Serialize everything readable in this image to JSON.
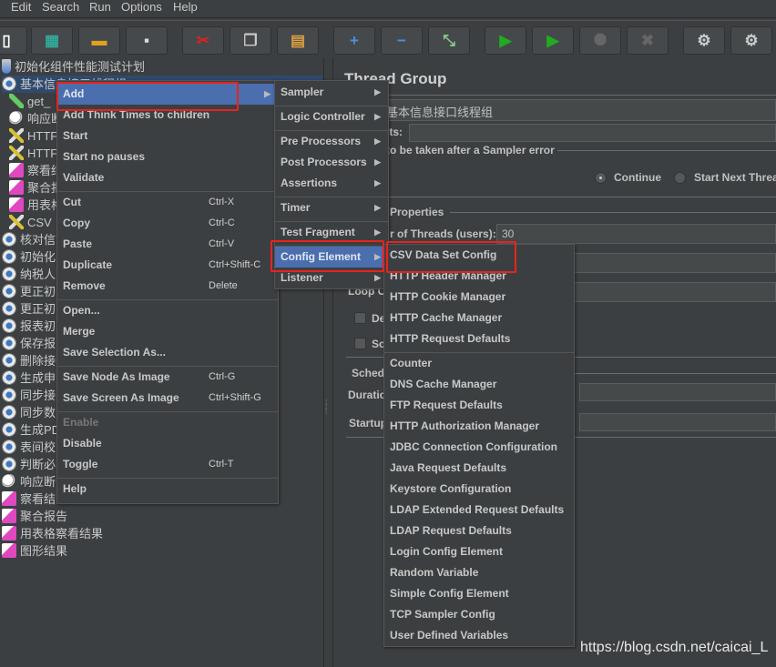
{
  "menubar": [
    "Edit",
    "Search",
    "Run",
    "Options",
    "Help"
  ],
  "toolbar": [
    {
      "icon": "new-icon",
      "g": "▯",
      "c": "#fff"
    },
    {
      "icon": "templates-icon",
      "g": "▦",
      "c": "#3a9"
    },
    {
      "icon": "open-icon",
      "g": "▬",
      "c": "#e0a020"
    },
    {
      "icon": "save-icon",
      "g": "▪",
      "c": "#ddd"
    },
    {
      "icon": "cut-icon",
      "g": "✂",
      "c": "#d22"
    },
    {
      "icon": "copy-icon",
      "g": "❐",
      "c": "#ccc"
    },
    {
      "icon": "paste-icon",
      "g": "▤",
      "c": "#e0a040"
    },
    {
      "icon": "expand-icon",
      "g": "+",
      "c": "#4a90e2"
    },
    {
      "icon": "collapse-icon",
      "g": "−",
      "c": "#4a90e2"
    },
    {
      "icon": "toggle-icon",
      "g": "⤡",
      "c": "#8c8"
    },
    {
      "icon": "start-icon",
      "g": "▶",
      "c": "#2a2"
    },
    {
      "icon": "start-no-pauses-icon",
      "g": "▶",
      "c": "#2a2"
    },
    {
      "icon": "stop-icon",
      "g": "⯃",
      "c": "#666"
    },
    {
      "icon": "shutdown-icon",
      "g": "✖",
      "c": "#666"
    },
    {
      "icon": "clear-icon",
      "g": "⚙",
      "c": "#ccc"
    },
    {
      "icon": "clear-all-icon",
      "g": "⚙",
      "c": "#ccc"
    }
  ],
  "tree": [
    {
      "label": "初始化组件性能测试计划",
      "icon": "flask",
      "indent": 0
    },
    {
      "label": "基本信息接口线程组",
      "icon": "gear",
      "indent": 0,
      "selected": true
    },
    {
      "label": "get_",
      "icon": "pen",
      "indent": 1
    },
    {
      "label": "响应断",
      "icon": "glass",
      "indent": 1
    },
    {
      "label": "HTTF",
      "icon": "tool",
      "indent": 1
    },
    {
      "label": "HTTF",
      "icon": "tool",
      "indent": 1
    },
    {
      "label": "察看结",
      "icon": "chart",
      "indent": 1
    },
    {
      "label": "聚合报",
      "icon": "chart",
      "indent": 1
    },
    {
      "label": "用表格",
      "icon": "chart",
      "indent": 1
    },
    {
      "label": "CSV",
      "icon": "tool",
      "indent": 1
    },
    {
      "label": "核对信",
      "icon": "gear",
      "indent": 0
    },
    {
      "label": "初始化",
      "icon": "gear",
      "indent": 0
    },
    {
      "label": "纳税人",
      "icon": "gear",
      "indent": 0
    },
    {
      "label": "更正初",
      "icon": "gear",
      "indent": 0
    },
    {
      "label": "更正初",
      "icon": "gear",
      "indent": 0
    },
    {
      "label": "报表初",
      "icon": "gear",
      "indent": 0
    },
    {
      "label": "保存报",
      "icon": "gear",
      "indent": 0
    },
    {
      "label": "删除接",
      "icon": "gear",
      "indent": 0
    },
    {
      "label": "生成申",
      "icon": "gear",
      "indent": 0
    },
    {
      "label": "同步接",
      "icon": "gear",
      "indent": 0
    },
    {
      "label": "同步数",
      "icon": "gear",
      "indent": 0
    },
    {
      "label": "生成PD",
      "icon": "gear",
      "indent": 0
    },
    {
      "label": "表间校",
      "icon": "gear",
      "indent": 0
    },
    {
      "label": "判断必",
      "icon": "gear",
      "indent": 0
    },
    {
      "label": "响应断",
      "icon": "glass",
      "indent": 0
    },
    {
      "label": "察看结",
      "icon": "chart",
      "indent": 0
    },
    {
      "label": "聚合报告",
      "icon": "chart",
      "indent": 0
    },
    {
      "label": "用表格察看结果",
      "icon": "chart",
      "indent": 0
    },
    {
      "label": "图形结果",
      "icon": "chart",
      "indent": 0
    }
  ],
  "context_menu": [
    {
      "label": "Add",
      "submenu": true,
      "highlighted": true
    },
    {
      "label": "Add Think Times to children"
    },
    {
      "label": "Start"
    },
    {
      "label": "Start no pauses"
    },
    {
      "label": "Validate"
    },
    {
      "sep": true
    },
    {
      "label": "Cut",
      "shortcut": "Ctrl-X"
    },
    {
      "label": "Copy",
      "shortcut": "Ctrl-C"
    },
    {
      "label": "Paste",
      "shortcut": "Ctrl-V"
    },
    {
      "label": "Duplicate",
      "shortcut": "Ctrl+Shift-C"
    },
    {
      "label": "Remove",
      "shortcut": "Delete"
    },
    {
      "sep": true
    },
    {
      "label": "Open..."
    },
    {
      "label": "Merge"
    },
    {
      "label": "Save Selection As..."
    },
    {
      "sep": true
    },
    {
      "label": "Save Node As Image",
      "shortcut": "Ctrl-G"
    },
    {
      "label": "Save Screen As Image",
      "shortcut": "Ctrl+Shift-G"
    },
    {
      "sep": true
    },
    {
      "label": "Enable",
      "disabled": true
    },
    {
      "label": "Disable"
    },
    {
      "label": "Toggle",
      "shortcut": "Ctrl-T"
    },
    {
      "sep": true
    },
    {
      "label": "Help"
    }
  ],
  "add_menu": [
    {
      "label": "Sampler"
    },
    {
      "sep": true
    },
    {
      "label": "Logic Controller"
    },
    {
      "sep": true
    },
    {
      "label": "Pre Processors"
    },
    {
      "label": "Post Processors"
    },
    {
      "label": "Assertions"
    },
    {
      "sep": true
    },
    {
      "label": "Timer"
    },
    {
      "sep": true
    },
    {
      "label": "Test Fragment"
    },
    {
      "sep": true
    },
    {
      "label": "Config Element",
      "highlighted": true
    },
    {
      "label": "Listener"
    }
  ],
  "config_menu": [
    {
      "label": "CSV Data Set Config"
    },
    {
      "label": "HTTP Header Manager"
    },
    {
      "label": "HTTP Cookie Manager"
    },
    {
      "label": "HTTP Cache Manager"
    },
    {
      "label": "HTTP Request Defaults"
    },
    {
      "sep": true
    },
    {
      "label": "Counter"
    },
    {
      "label": "DNS Cache Manager"
    },
    {
      "label": "FTP Request Defaults"
    },
    {
      "label": "HTTP Authorization Manager"
    },
    {
      "label": "JDBC Connection Configuration"
    },
    {
      "label": "Java Request Defaults"
    },
    {
      "label": "Keystore Configuration"
    },
    {
      "label": "LDAP Extended Request Defaults"
    },
    {
      "label": "LDAP Request Defaults"
    },
    {
      "label": "Login Config Element"
    },
    {
      "label": "Random Variable"
    },
    {
      "label": "Simple Config Element"
    },
    {
      "label": "TCP Sampler Config"
    },
    {
      "label": "User Defined Variables"
    }
  ],
  "panel": {
    "title": "Thread Group",
    "name_value": "基本信息接口线程组",
    "comments_label": "ıts:",
    "error_group": "to be taken after a Sampler error",
    "radio_continue": "Continue",
    "radio_next": "Start Next Threa",
    "properties": "Properties",
    "threads_label": "r of Threads (users):",
    "threads_value": "30",
    "loop_label": "Loop C",
    "chk1": "De",
    "chk2": "Sc",
    "sched": "Sched",
    "duration": "Duratic",
    "startup": "Startup"
  },
  "watermark": "https://blog.csdn.net/caicai_L",
  "colors": {
    "highlight": "#4b6eaf",
    "annotation": "#e8231f"
  }
}
